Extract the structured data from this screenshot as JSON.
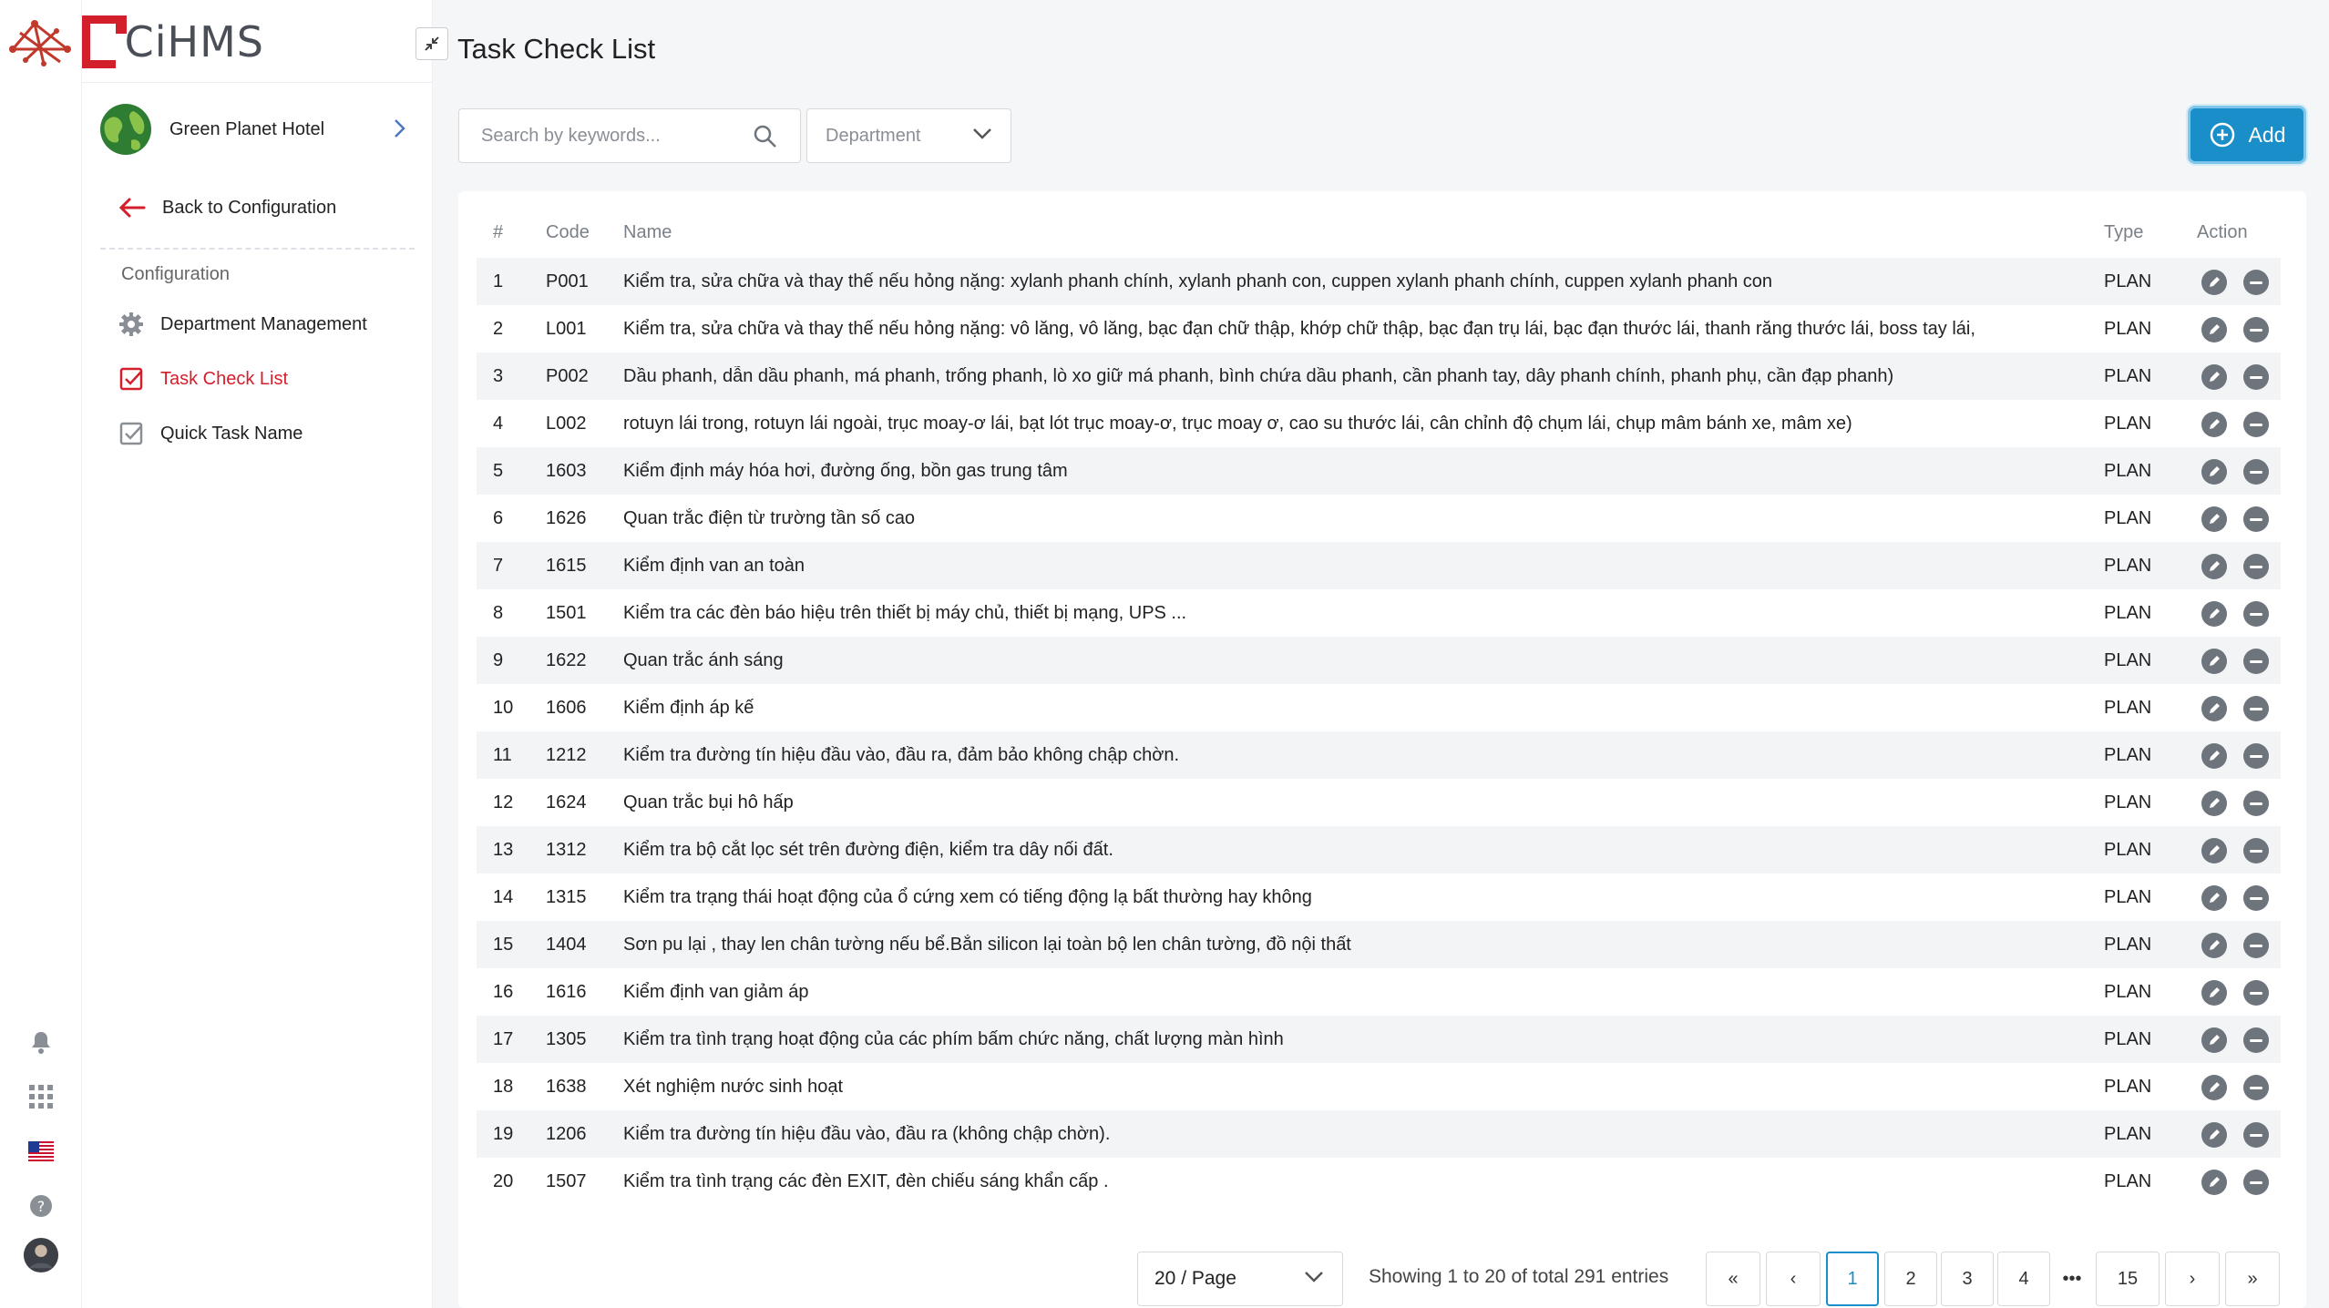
{
  "app": {
    "brand": "CiHMS"
  },
  "hotel": {
    "name": "Green Planet Hotel"
  },
  "sidebar": {
    "back_label": "Back to Configuration",
    "section": "Configuration",
    "items": [
      {
        "label": "Department Management"
      },
      {
        "label": "Task Check List"
      },
      {
        "label": "Quick Task Name"
      }
    ]
  },
  "page": {
    "title": "Task Check List"
  },
  "filters": {
    "search_placeholder": "Search by keywords...",
    "department_placeholder": "Department",
    "add_label": "Add"
  },
  "table": {
    "headers": {
      "num": "#",
      "code": "Code",
      "name": "Name",
      "type": "Type",
      "action": "Action"
    },
    "rows": [
      {
        "num": "1",
        "code": "P001",
        "name": "Kiểm tra, sửa chữa và thay thế nếu hỏng nặng: xylanh phanh chính, xylanh phanh con, cuppen xylanh phanh chính, cuppen xylanh phanh con",
        "type": "PLAN"
      },
      {
        "num": "2",
        "code": "L001",
        "name": "Kiểm tra, sửa chữa và thay thế nếu hỏng nặng: vô lăng, vô lăng, bạc đạn chữ thập, khớp chữ thập, bạc đạn trụ lái, bạc đạn thước lái, thanh răng thước lái, boss tay lái,",
        "type": "PLAN"
      },
      {
        "num": "3",
        "code": "P002",
        "name": "Dầu phanh, dẫn dầu phanh, má phanh, trống phanh, lò xo giữ má phanh, bình chứa dầu phanh, cần phanh tay, dây phanh chính, phanh phụ, cần đạp phanh)",
        "type": "PLAN"
      },
      {
        "num": "4",
        "code": "L002",
        "name": "rotuyn lái trong, rotuyn lái ngoài, trục moay-ơ lái, bạt lót trục moay-ơ, trục moay ơ, cao su thước lái, cân chỉnh độ chụm lái, chụp mâm bánh xe, mâm xe)",
        "type": "PLAN"
      },
      {
        "num": "5",
        "code": "1603",
        "name": "Kiểm định máy hóa hơi, đường ống, bồn gas trung tâm",
        "type": "PLAN"
      },
      {
        "num": "6",
        "code": "1626",
        "name": "Quan trắc điện từ trường tần số cao",
        "type": "PLAN"
      },
      {
        "num": "7",
        "code": "1615",
        "name": "Kiểm định van an toàn",
        "type": "PLAN"
      },
      {
        "num": "8",
        "code": "1501",
        "name": "Kiểm tra các đèn báo hiệu trên thiết bị máy chủ, thiết bị mạng, UPS ...",
        "type": "PLAN"
      },
      {
        "num": "9",
        "code": "1622",
        "name": "Quan trắc ánh sáng",
        "type": "PLAN"
      },
      {
        "num": "10",
        "code": "1606",
        "name": "Kiểm định áp kế",
        "type": "PLAN"
      },
      {
        "num": "11",
        "code": "1212",
        "name": "Kiểm tra đường tín hiệu đầu vào, đầu ra, đảm bảo không chập chờn.",
        "type": "PLAN"
      },
      {
        "num": "12",
        "code": "1624",
        "name": "Quan trắc bụi hô hấp",
        "type": "PLAN"
      },
      {
        "num": "13",
        "code": "1312",
        "name": "Kiểm tra bộ cắt lọc sét trên đường điện, kiểm tra dây nối đất.",
        "type": "PLAN"
      },
      {
        "num": "14",
        "code": "1315",
        "name": "Kiểm tra trạng thái hoạt động của ổ cứng xem có tiếng động lạ bất thường hay không",
        "type": "PLAN"
      },
      {
        "num": "15",
        "code": "1404",
        "name": "Sơn pu lại , thay len chân tường nếu bể.Bắn silicon lại toàn bộ len chân tường, đồ nội thất",
        "type": "PLAN"
      },
      {
        "num": "16",
        "code": "1616",
        "name": "Kiểm định van giảm áp",
        "type": "PLAN"
      },
      {
        "num": "17",
        "code": "1305",
        "name": "Kiểm tra tình trạng hoạt động của các phím bấm chức năng, chất lượng màn hình",
        "type": "PLAN"
      },
      {
        "num": "18",
        "code": "1638",
        "name": "Xét nghiệm nước sinh hoạt",
        "type": "PLAN"
      },
      {
        "num": "19",
        "code": "1206",
        "name": "Kiểm tra đường tín hiệu đầu vào, đầu ra (không chập chờn).",
        "type": "PLAN"
      },
      {
        "num": "20",
        "code": "1507",
        "name": "Kiểm tra tình trạng các đèn EXIT, đèn chiếu sáng khẩn cấp .",
        "type": "PLAN"
      }
    ]
  },
  "pagination": {
    "page_size": "20 / Page",
    "showing": "Showing 1 to 20 of total 291 entries",
    "pages": [
      "1",
      "2",
      "3",
      "4"
    ],
    "ellipsis": "•••",
    "last": "15",
    "first_icon": "«",
    "prev_icon": "‹",
    "next_icon": "›",
    "last_icon": "»"
  },
  "colors": {
    "accent": "#1a8ec9",
    "brand_red": "#d31f2b",
    "action_gray": "#6e747c"
  }
}
